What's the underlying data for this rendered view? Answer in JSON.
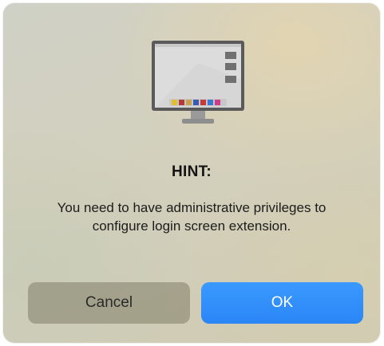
{
  "dialog": {
    "illustration": "login-screen-monitor-illustration",
    "title": "HINT:",
    "message": "You need to have administrative privileges to configure login screen extension.",
    "buttons": {
      "cancel_label": "Cancel",
      "ok_label": "OK"
    }
  },
  "colors": {
    "ok_button": "#2a86f5",
    "cancel_button": "#8a8670"
  }
}
